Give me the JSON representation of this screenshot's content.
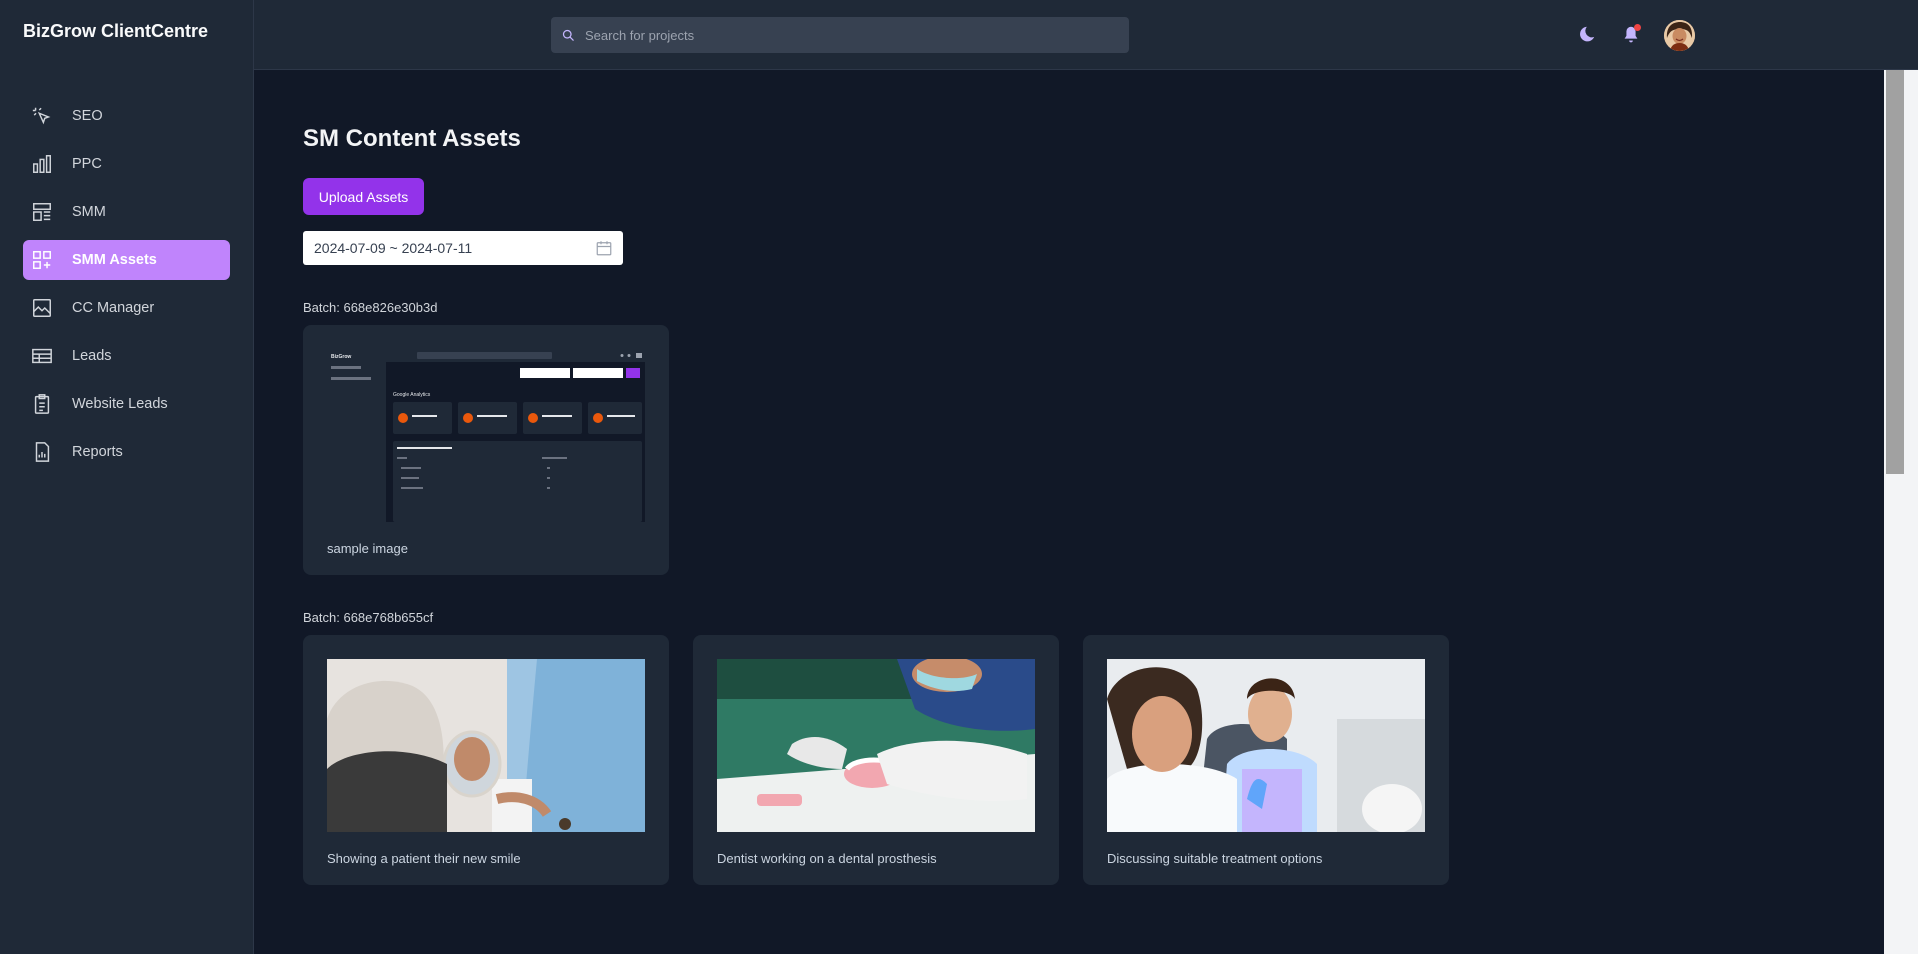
{
  "app": {
    "brand": "BizGrow ClientCentre"
  },
  "search": {
    "placeholder": "Search for projects"
  },
  "sidebar": {
    "items": [
      {
        "label": "SEO",
        "icon": "cursor-click-icon",
        "active": false
      },
      {
        "label": "PPC",
        "icon": "bar-chart-icon",
        "active": false
      },
      {
        "label": "SMM",
        "icon": "layout-icon",
        "active": false
      },
      {
        "label": "SMM Assets",
        "icon": "grid-plus-icon",
        "active": true
      },
      {
        "label": "CC Manager",
        "icon": "image-icon",
        "active": false
      },
      {
        "label": "Leads",
        "icon": "table-icon",
        "active": false
      },
      {
        "label": "Website Leads",
        "icon": "clipboard-icon",
        "active": false
      },
      {
        "label": "Reports",
        "icon": "report-icon",
        "active": false
      }
    ]
  },
  "header": {
    "icons": [
      "moon-icon",
      "bell-icon",
      "avatar"
    ],
    "accent": "#c084fc"
  },
  "page": {
    "title": "SM Content Assets",
    "upload_label": "Upload Assets",
    "date_range": "2024-07-09 ~ 2024-07-11"
  },
  "batches": [
    {
      "label": "Batch: 668e826e30b3d",
      "assets": [
        {
          "caption": "sample image"
        }
      ]
    },
    {
      "label": "Batch: 668e768b655cf",
      "assets": [
        {
          "caption": "Showing a patient their new smile"
        },
        {
          "caption": "Dentist working on a dental prosthesis"
        },
        {
          "caption": "Discussing suitable treatment options"
        }
      ]
    }
  ],
  "mini_screenshot": {
    "brand": "BizGrow",
    "section": "Google Analytics"
  },
  "colors": {
    "primary": "#9333ea",
    "active_nav": "#c084fc",
    "bg": "#111827",
    "panel": "#1f2937"
  }
}
